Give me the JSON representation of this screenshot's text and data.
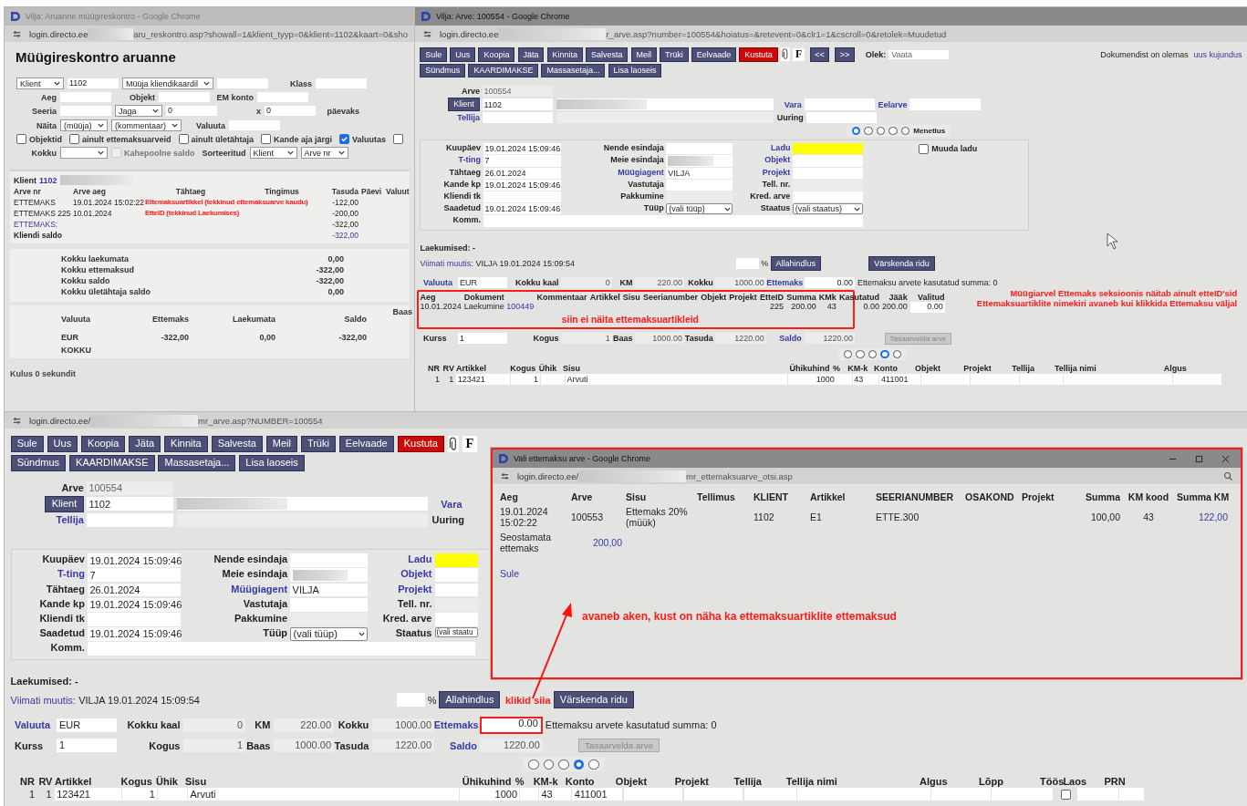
{
  "report_window": {
    "title": "Vilja: Aruanne müügireskontro - Google Chrome",
    "url_host": "login.directo.ee",
    "url_path": "aru_reskontro.asp?showall=1&klient_tyyp=0&klient=1102&kaart=0&sho",
    "heading": "Müügireskontro aruanne",
    "filters": [
      {
        "items": [
          {
            "kind": "select",
            "value": "Klient"
          },
          {
            "kind": "input",
            "value": "1102"
          },
          {
            "kind": "select",
            "value": "Müüja kliendikaardil"
          },
          {
            "kind": "input"
          },
          {
            "kind": "label",
            "text": "Klass"
          },
          {
            "kind": "input"
          }
        ]
      },
      {
        "items": [
          {
            "kind": "label",
            "text": "Aeg"
          },
          {
            "kind": "input"
          },
          {
            "kind": "label",
            "text": "Objekt"
          },
          {
            "kind": "input"
          },
          {
            "kind": "label",
            "text": "EM konto"
          },
          {
            "kind": "input"
          }
        ]
      },
      {
        "items": [
          {
            "kind": "label",
            "text": "Seeria"
          },
          {
            "kind": "input"
          },
          {
            "kind": "select",
            "value": "Jaga"
          },
          {
            "kind": "input",
            "value": "0"
          },
          {
            "kind": "label",
            "text": "x"
          },
          {
            "kind": "input",
            "value": "0"
          },
          {
            "kind": "label",
            "text": "päevaks"
          }
        ]
      },
      {
        "items": [
          {
            "kind": "label",
            "text": "Näita"
          },
          {
            "kind": "select",
            "value": "(müüja)"
          },
          {
            "kind": "select",
            "value": "(kommentaar)"
          },
          {
            "kind": "label",
            "text": "Valuuta"
          },
          {
            "kind": "input"
          }
        ]
      },
      {
        "items": [
          {
            "kind": "checkbox",
            "text": "Objektid",
            "checked": false,
            "disabled": false
          },
          {
            "kind": "checkbox",
            "text": "ainult ettemaksuarveid",
            "checked": false,
            "disabled": false
          },
          {
            "kind": "checkbox",
            "text": "ainult ületähtaja",
            "checked": false,
            "disabled": false
          },
          {
            "kind": "checkbox",
            "text": "Kande aja järgi",
            "checked": false,
            "disabled": false
          },
          {
            "kind": "checkbox",
            "text": "Valuutas",
            "checked": true,
            "disabled": false
          },
          {
            "kind": "checkbox",
            "checked": false,
            "disabled": false
          }
        ]
      },
      {
        "items": [
          {
            "kind": "label",
            "text": "Kokku"
          },
          {
            "kind": "select"
          },
          {
            "kind": "checkbox",
            "text": "Kahepoolne saldo",
            "checked": false,
            "disabled": true
          },
          {
            "kind": "label",
            "text": "Sorteeritud"
          },
          {
            "kind": "select",
            "value": "Klient"
          },
          {
            "kind": "select",
            "value": "Arve nr"
          }
        ]
      }
    ],
    "client": {
      "label": "Klient",
      "link": "1102"
    },
    "columns": [
      "Arve nr",
      "Arve aeg",
      "Tähtaeg",
      "Tingimus",
      "Tasuda",
      "Päevi",
      "Valuut"
    ],
    "rows": [
      {
        "kind": "entry",
        "arve_nr": "ETTEMAKS",
        "arve_aeg": "19.01.2024 15:02:22",
        "note": "Ettemaksuartikkel (tekkinud ettemaksuarve kaudu)",
        "tasuda": "-122,00"
      },
      {
        "kind": "entry",
        "arve_nr": "ETTEMAKS 225",
        "arve_aeg": "10.01.2024",
        "note": "EtteID (tekkinud Laekumises)",
        "tasuda": "-200,00"
      },
      {
        "kind": "subtotal",
        "arve_nr": "ETTEMAKS:",
        "tasuda": "-322,00"
      },
      {
        "kind": "saldo",
        "arve_nr": "Kliendi saldo",
        "tasuda": "-322,00"
      }
    ],
    "totals": [
      {
        "label": "Kokku laekumata",
        "value": "0,00"
      },
      {
        "label": "Kokku ettemaksud",
        "value": "-322,00"
      },
      {
        "label": "Kokku saldo",
        "value": "-322,00"
      },
      {
        "label": "Kokku ületähtaja saldo",
        "value": "0,00"
      }
    ],
    "currency_columns": [
      "Valuuta",
      "Ettemaks",
      "Laekumata",
      "Saldo",
      "Baas"
    ],
    "currency_rows": [
      [
        "EUR",
        "-322,00",
        "0,00",
        "-322,00"
      ],
      [
        "KOKKU"
      ]
    ],
    "footer": "Kulus 0 sekundit"
  },
  "invoice_windows": [
    {
      "title": "Vilja: Arve: 100554 - Google Chrome",
      "url_host": "login.directo.ee",
      "url_path": "r_arve.asp?number=100554&hoiatus=&retevent=0&clr1=1&cscroll=0&retolek=Muudetud",
      "buttons": [
        {
          "label": "Sule",
          "kind": "normal"
        },
        {
          "label": "Uus",
          "kind": "normal"
        },
        {
          "label": "Koopia",
          "kind": "normal"
        },
        {
          "label": "Jäta",
          "kind": "normal"
        },
        {
          "label": "Kinnita",
          "kind": "normal"
        },
        {
          "label": "Salvesta",
          "kind": "normal"
        },
        {
          "label": "Meil",
          "kind": "normal"
        },
        {
          "label": "Trüki",
          "kind": "normal"
        },
        {
          "label": "Eelvaade",
          "kind": "normal"
        },
        {
          "label": "Kustuta",
          "kind": "danger"
        }
      ],
      "format_button": "F",
      "nav_buttons": [
        "<<",
        ">>"
      ],
      "status": {
        "label": "Olek:",
        "value": "Vaata"
      },
      "notice": {
        "text": "Dokumendist on olemas",
        "link": "uus kujundus"
      },
      "buttons_2": [
        "Sündmus",
        "KAARDIMAKSE",
        "Massasetaja...",
        "Lisa laoseis"
      ],
      "head": {
        "arve": {
          "label": "Arve",
          "value": "100554"
        },
        "klient": {
          "label": "Klient",
          "value": "1102"
        },
        "tellija": {
          "label": "Tellija"
        },
        "right_1": [
          {
            "label": "Vara",
            "link": true,
            "has_field": true
          },
          {
            "label": "Eelarve",
            "link": true,
            "has_field": true
          }
        ],
        "right_2": [
          {
            "label": "Uuring",
            "link": false,
            "has_field": true
          }
        ]
      },
      "radios": [
        {
          "selected": true
        },
        {
          "selected": false
        },
        {
          "selected": false
        },
        {
          "selected": false
        },
        {
          "selected": false,
          "label": "Menetlus"
        }
      ],
      "fields": [
        [
          {
            "label": "Kuupäev",
            "value": "19.01.2024 15:09:46",
            "kind": "text",
            "link": false
          },
          {
            "label": "T-ting",
            "value": "7",
            "kind": "text",
            "link": true
          },
          {
            "label": "Tähtaeg",
            "value": "26.01.2024",
            "kind": "text",
            "link": false
          },
          {
            "label": "Kande kp",
            "value": "19.01.2024 15:09:46",
            "kind": "text",
            "link": false
          },
          {
            "label": "Kliendi tk",
            "kind": "text",
            "link": false
          },
          {
            "label": "Saadetud",
            "value": "19.01.2024 15:09:46",
            "kind": "text",
            "link": false
          }
        ],
        [
          {
            "label": "Nende esindaja",
            "kind": "text",
            "link": false
          },
          {
            "label": "Meie esindaja",
            "kind": "blurred",
            "link": false
          },
          {
            "label": "Müügiagent",
            "value": "VILJA",
            "kind": "text",
            "link": true
          },
          {
            "label": "Vastutaja",
            "kind": "text",
            "link": false
          },
          {
            "label": "Pakkumine",
            "kind": "readonly",
            "link": false
          },
          {
            "label": "Tüüp",
            "value": "(vali tüüp)",
            "kind": "select",
            "link": false
          }
        ],
        [
          {
            "label": "Ladu",
            "kind": "yellow",
            "link": true
          },
          {
            "label": "Objekt",
            "kind": "text",
            "link": true
          },
          {
            "label": "Projekt",
            "kind": "text",
            "link": true
          },
          {
            "label": "Tell. nr.",
            "kind": "readonly",
            "link": false
          },
          {
            "label": "Kred. arve",
            "kind": "text",
            "link": false
          },
          {
            "label": "Staatus",
            "value": "(vali staatus)",
            "kind": "select",
            "link": false
          }
        ]
      ],
      "muuda_ladu": {
        "label": "Muuda ladu",
        "checked": false
      },
      "comment_label": "Komm.",
      "laekumised": "Laekumised: -",
      "last_change": {
        "label": "Viimati muutis:",
        "value": "VILJA 19.01.2024 15:09:54"
      },
      "discount": {
        "unit": "%",
        "button": "Allahindlus"
      },
      "refresh_button": "Värskenda ridu",
      "summary": [
        [
          {
            "label": "Valuuta",
            "link": true,
            "value": "EUR",
            "kind": "text"
          },
          {
            "label": "Kokku kaal",
            "link": false,
            "value": "0",
            "kind": "number"
          },
          {
            "label": "KM",
            "link": false,
            "value": "220.00",
            "kind": "number"
          },
          {
            "label": "Kokku",
            "link": false,
            "value": "1000.00",
            "kind": "number"
          },
          {
            "label": "Ettemaks",
            "link": true,
            "value": "0.00",
            "kind": "number_input",
            "highlighted": false
          }
        ],
        [
          {
            "label": "Kurss",
            "link": false,
            "value": "1",
            "kind": "text"
          },
          {
            "label": "Kogus",
            "link": false,
            "value": "1",
            "kind": "number"
          },
          {
            "label": "Baas",
            "link": false,
            "value": "1000.00",
            "kind": "number"
          },
          {
            "label": "Tasuda",
            "link": false,
            "value": "1220.00",
            "kind": "number"
          },
          {
            "label": "Saldo",
            "link": true,
            "value": "1220.00",
            "kind": "number"
          }
        ]
      ],
      "used_note": "Ettemaksu arvete kasutatud summa: 0",
      "offset_button": {
        "label": "Tasaarvelda arve",
        "disabled": true
      },
      "prepayments": {
        "columns": [
          {
            "label": "Aeg",
            "kind": "text"
          },
          {
            "label": "Dokument",
            "kind": "document"
          },
          {
            "label": "Kommentaar",
            "kind": "text"
          },
          {
            "label": "Artikkel",
            "kind": "text"
          },
          {
            "label": "Sisu",
            "kind": "text"
          },
          {
            "label": "Seerianumber",
            "kind": "text"
          },
          {
            "label": "Objekt",
            "kind": "text"
          },
          {
            "label": "Projekt",
            "kind": "text"
          },
          {
            "label": "EtteID",
            "kind": "number"
          },
          {
            "label": "Summa",
            "kind": "number"
          },
          {
            "label": "KMk",
            "kind": "number"
          },
          {
            "label": "Kasutatud",
            "kind": "number"
          },
          {
            "label": "Jääk",
            "kind": "number"
          },
          {
            "label": "Valitud",
            "kind": "input"
          }
        ],
        "rows": [
          [
            "10.01.2024",
            {
              "text": "Laekumine",
              "link": "100449"
            },
            null,
            null,
            null,
            null,
            null,
            null,
            "225",
            "200.00",
            "43",
            "0.00",
            "200.00",
            "0.00"
          ]
        ],
        "note": "siin ei näita ettemaksuartikleid"
      },
      "side_notes": [
        "Müügiarvel Ettemaks seksioonis näitab ainult etteID'sid",
        "Ettemaksuartiklite nimekiri avaneb kui klikkida Ettemaksu väljal"
      ],
      "radios_2": [
        {
          "selected": false
        },
        {
          "selected": false
        },
        {
          "selected": false
        },
        {
          "selected": true
        },
        {
          "selected": false
        }
      ],
      "items": {
        "columns": [
          {
            "label": "NR",
            "kind": "index"
          },
          {
            "label": "RV",
            "kind": "index"
          },
          {
            "label": "Artikkel",
            "kind": "text"
          },
          {
            "label": "Kogus",
            "kind": "number"
          },
          {
            "label": "Ühik",
            "kind": "text"
          },
          {
            "label": "Sisu",
            "kind": "text"
          },
          {
            "label": "Ühikuhind",
            "kind": "number"
          },
          {
            "label": "%",
            "kind": "text"
          },
          {
            "label": "KM-k",
            "kind": "text"
          },
          {
            "label": "Konto",
            "kind": "text"
          },
          {
            "label": "Objekt",
            "kind": "text"
          },
          {
            "label": "Projekt",
            "kind": "text"
          },
          {
            "label": "Tellija",
            "kind": "text"
          },
          {
            "label": "Tellija nimi",
            "kind": "text"
          },
          {
            "label": "Algus",
            "kind": "text"
          }
        ],
        "rows": [
          [
            "1",
            "1",
            "123421",
            "1",
            null,
            "Arvuti",
            "1000",
            null,
            "43",
            "411001",
            null,
            null,
            null,
            null,
            null
          ]
        ]
      }
    },
    {
      "url_host": "login.directo.ee/",
      "url_path": "mr_arve.asp?NUMBER=100554",
      "buttons": [
        {
          "label": "Sule",
          "kind": "normal"
        },
        {
          "label": "Uus",
          "kind": "normal"
        },
        {
          "label": "Koopia",
          "kind": "normal"
        },
        {
          "label": "Jäta",
          "kind": "normal"
        },
        {
          "label": "Kinnita",
          "kind": "normal"
        },
        {
          "label": "Salvesta",
          "kind": "normal"
        },
        {
          "label": "Meil",
          "kind": "normal"
        },
        {
          "label": "Trüki",
          "kind": "normal"
        },
        {
          "label": "Eelvaade",
          "kind": "normal"
        },
        {
          "label": "Kustuta",
          "kind": "danger"
        }
      ],
      "format_button": "F",
      "buttons_2": [
        "Sündmus",
        "KAARDIMAKSE",
        "Massasetaja...",
        "Lisa laoseis"
      ],
      "head": {
        "arve": {
          "label": "Arve",
          "value": "100554"
        },
        "klient": {
          "label": "Klient",
          "value": "1102"
        },
        "tellija": {
          "label": "Tellija"
        },
        "right_1": [
          {
            "label": "Vara",
            "link": true,
            "has_field": false
          }
        ],
        "right_2": [
          {
            "label": "Uuring",
            "link": false,
            "has_field": false
          }
        ]
      },
      "fields": [
        [
          {
            "label": "Kuupäev",
            "value": "19.01.2024 15:09:46",
            "kind": "text",
            "link": false
          },
          {
            "label": "T-ting",
            "value": "7",
            "kind": "text",
            "link": true
          },
          {
            "label": "Tähtaeg",
            "value": "26.01.2024",
            "kind": "text",
            "link": false
          },
          {
            "label": "Kande kp",
            "value": "19.01.2024 15:09:46",
            "kind": "text",
            "link": false
          },
          {
            "label": "Kliendi tk",
            "kind": "text",
            "link": false
          },
          {
            "label": "Saadetud",
            "value": "19.01.2024 15:09:46",
            "kind": "text",
            "link": false
          }
        ],
        [
          {
            "label": "Nende esindaja",
            "kind": "text",
            "link": false
          },
          {
            "label": "Meie esindaja",
            "kind": "blurred",
            "link": false
          },
          {
            "label": "Müügiagent",
            "value": "VILJA",
            "kind": "text",
            "link": true
          },
          {
            "label": "Vastutaja",
            "kind": "text",
            "link": false
          },
          {
            "label": "Pakkumine",
            "kind": "readonly",
            "link": false
          },
          {
            "label": "Tüüp",
            "value": "(vali tüüp)",
            "kind": "select",
            "link": false
          }
        ],
        [
          {
            "label": "Ladu",
            "kind": "yellow",
            "link": true
          },
          {
            "label": "Objekt",
            "kind": "text",
            "link": true
          },
          {
            "label": "Projekt",
            "kind": "text",
            "link": true
          },
          {
            "label": "Tell. nr.",
            "kind": "readonly",
            "link": false
          },
          {
            "label": "Kred. arve",
            "kind": "text",
            "link": false
          },
          {
            "label": "Staatus",
            "value": "(vali staatu",
            "kind": "select",
            "link": false
          }
        ]
      ],
      "comment_label": "Komm.",
      "laekumised": "Laekumised: -",
      "last_change": {
        "label": "Viimati muutis:",
        "value": "VILJA 19.01.2024 15:09:54"
      },
      "discount": {
        "unit": "%",
        "button": "Allahindlus"
      },
      "refresh_button": "Värskenda ridu",
      "summary": [
        [
          {
            "label": "Valuuta",
            "link": true,
            "value": "EUR",
            "kind": "text"
          },
          {
            "label": "Kokku kaal",
            "link": false,
            "value": "0",
            "kind": "number"
          },
          {
            "label": "KM",
            "link": false,
            "value": "220.00",
            "kind": "number"
          },
          {
            "label": "Kokku",
            "link": false,
            "value": "1000.00",
            "kind": "number"
          },
          {
            "label": "Ettemaks",
            "link": true,
            "value": "0.00",
            "kind": "number_input",
            "highlighted": true,
            "callout": "klikid siia"
          }
        ],
        [
          {
            "label": "Kurss",
            "link": false,
            "value": "1",
            "kind": "text"
          },
          {
            "label": "Kogus",
            "link": false,
            "value": "1",
            "kind": "number"
          },
          {
            "label": "Baas",
            "link": false,
            "value": "1000.00",
            "kind": "number"
          },
          {
            "label": "Tasuda",
            "link": false,
            "value": "1220.00",
            "kind": "number"
          },
          {
            "label": "Saldo",
            "link": true,
            "value": "1220.00",
            "kind": "number"
          }
        ]
      ],
      "used_note": "Ettemaksu arvete kasutatud summa: 0",
      "offset_button": {
        "label": "Tasaarvelda arve",
        "disabled": true
      },
      "radios_2": [
        {
          "selected": false
        },
        {
          "selected": false
        },
        {
          "selected": false
        },
        {
          "selected": true
        },
        {
          "selected": false
        }
      ],
      "items": {
        "columns": [
          {
            "label": "NR",
            "kind": "index"
          },
          {
            "label": "RV",
            "kind": "index"
          },
          {
            "label": "Artikkel",
            "kind": "text"
          },
          {
            "label": "Kogus",
            "kind": "number"
          },
          {
            "label": "Ühik",
            "kind": "text"
          },
          {
            "label": "Sisu",
            "kind": "text"
          },
          {
            "label": "Ühikuhind",
            "kind": "number"
          },
          {
            "label": "%",
            "kind": "text"
          },
          {
            "label": "KM-k",
            "kind": "text"
          },
          {
            "label": "Konto",
            "kind": "text"
          },
          {
            "label": "Objekt",
            "kind": "text"
          },
          {
            "label": "Projekt",
            "kind": "text"
          },
          {
            "label": "Tellija",
            "kind": "text"
          },
          {
            "label": "Tellija nimi",
            "kind": "text"
          },
          {
            "label": "Algus",
            "kind": "text"
          },
          {
            "label": "Lõpp",
            "kind": "text"
          },
          {
            "label": "Töös",
            "kind": "checkbox"
          },
          {
            "label": "Laos",
            "kind": "text"
          },
          {
            "label": "PRN",
            "kind": "text"
          }
        ],
        "rows": [
          [
            "1",
            "1",
            "123421",
            "1",
            null,
            "Arvuti",
            "1000",
            null,
            "43",
            "411001",
            null,
            null,
            null,
            null,
            null,
            null,
            false,
            null,
            null
          ]
        ]
      }
    }
  ],
  "popup_window": {
    "title": "Vali ettemaksu arve - Google Chrome",
    "url_host": "login.directo.ee/",
    "url_path": "mr_ettemaksuarve_otsi.asp",
    "columns": [
      "Aeg",
      "Arve",
      "Sisu",
      "Tellimus",
      "KLIENT",
      "Artikkel",
      "SEERIANUMBER",
      "OSAKOND",
      "Projekt",
      "Summa",
      "KM kood",
      "Summa KM"
    ],
    "rows": [
      [
        {
          "text": "19.01.2024 15:02:22",
          "link": false
        },
        {
          "text": "100553",
          "link": false
        },
        {
          "text": "Ettemaks 20% (müük)",
          "link": false
        },
        null,
        {
          "text": "1102",
          "link": false
        },
        {
          "text": "E1",
          "link": false
        },
        {
          "text": "ETTE.300",
          "link": false
        },
        null,
        null,
        {
          "text": "100,00",
          "link": false
        },
        {
          "text": "43",
          "link": false
        },
        {
          "text": "122,00",
          "link": true
        }
      ],
      [
        {
          "text": "Seostamata ettemaks",
          "link": false
        },
        {
          "text": "200,00",
          "link": true
        }
      ]
    ],
    "close_link": "Sule",
    "note": "avaneb aken, kust on näha ka ettemaksuartiklite ettemaksud"
  }
}
